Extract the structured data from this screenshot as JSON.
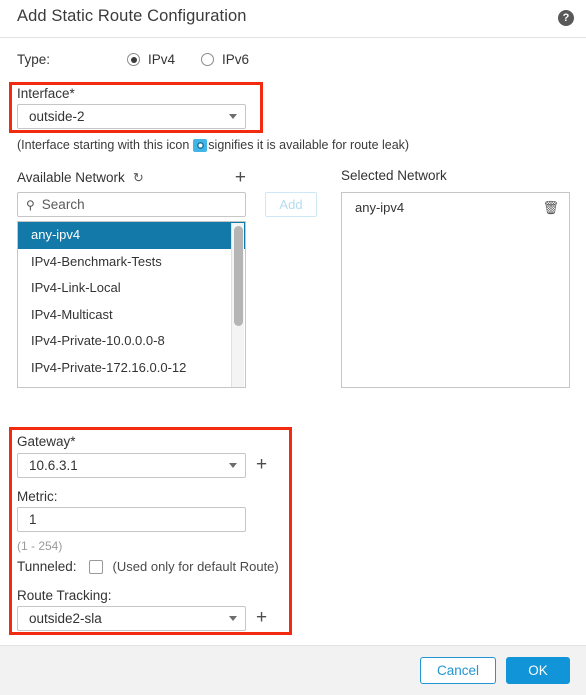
{
  "dialog": {
    "title": "Add Static Route Configuration",
    "help_icon": "help-circle-icon"
  },
  "type": {
    "label": "Type:",
    "options": [
      {
        "label": "IPv4",
        "selected": true
      },
      {
        "label": "IPv6",
        "selected": false
      }
    ]
  },
  "interface": {
    "label": "Interface*",
    "value": "outside-2",
    "hint_prefix": "(Interface starting with this icon",
    "hint_suffix": "signifies it is available for route leak)",
    "icon_name": "route-leak-icon"
  },
  "available_network": {
    "header": "Available Network",
    "refresh_icon": "refresh-icon",
    "add_new_icon": "plus-icon",
    "search_placeholder": "Search",
    "search_value": "",
    "items": [
      {
        "label": "any-ipv4",
        "selected": true
      },
      {
        "label": "IPv4-Benchmark-Tests",
        "selected": false
      },
      {
        "label": "IPv4-Link-Local",
        "selected": false
      },
      {
        "label": "IPv4-Multicast",
        "selected": false
      },
      {
        "label": "IPv4-Private-10.0.0.0-8",
        "selected": false
      },
      {
        "label": "IPv4-Private-172.16.0.0-12",
        "selected": false
      }
    ]
  },
  "add_button": {
    "label": "Add",
    "enabled": false
  },
  "selected_network": {
    "header": "Selected Network",
    "items": [
      {
        "label": "any-ipv4",
        "delete_icon": "trash-icon"
      }
    ]
  },
  "gateway": {
    "label": "Gateway*",
    "value": "10.6.3.1",
    "add_icon": "plus-icon"
  },
  "metric": {
    "label": "Metric:",
    "value": "1",
    "range_hint": "(1 - 254)"
  },
  "tunneled": {
    "label": "Tunneled:",
    "checked": false,
    "hint": "(Used only for default Route)"
  },
  "route_tracking": {
    "label": "Route Tracking:",
    "value": "outside2-sla",
    "add_icon": "plus-icon"
  },
  "footer": {
    "cancel_label": "Cancel",
    "ok_label": "OK"
  },
  "annotations": {
    "highlight_color": "#f22a10",
    "boxes": [
      "interface-field",
      "gateway-metric-tracking-group"
    ]
  },
  "colors": {
    "accent": "#1295d8",
    "selection": "#1279a8",
    "link": "#2196d3"
  }
}
